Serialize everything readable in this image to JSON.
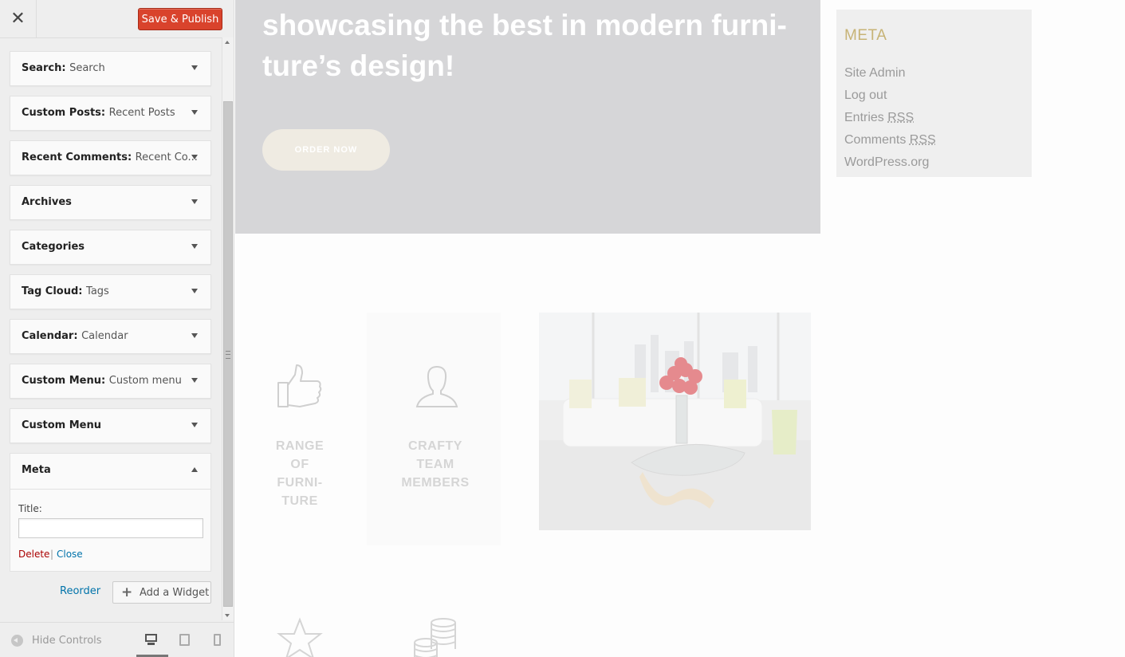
{
  "topbar": {
    "close_glyph": "✕",
    "save_label": "Save & Publish"
  },
  "widgets": [
    {
      "name": "Search",
      "sub": "Search"
    },
    {
      "name": "Custom Posts",
      "sub": "Recent Posts"
    },
    {
      "name": "Recent Comments",
      "sub": "Recent Co..."
    },
    {
      "name": "Archives",
      "sub": ""
    },
    {
      "name": "Categories",
      "sub": ""
    },
    {
      "name": "Tag Cloud",
      "sub": "Tags"
    },
    {
      "name": "Calendar",
      "sub": "Calendar"
    },
    {
      "name": "Custom Menu",
      "sub": "Custom menu"
    },
    {
      "name": "Custom Menu",
      "sub": ""
    }
  ],
  "meta_widget": {
    "name": "Meta",
    "title_label": "Title:",
    "title_value": "",
    "delete_label": "Delete",
    "separator": "|",
    "close_label": "Close"
  },
  "actions": {
    "reorder_label": "Reorder",
    "add_widget_plus": "+",
    "add_widget_label": "Add a Widget"
  },
  "footer": {
    "hide_controls_label": "Hide Controls",
    "devices": [
      "desktop-icon",
      "tablet-icon",
      "mobile-icon"
    ],
    "active_device": "desktop"
  },
  "preview": {
    "hero_heading": "showcasing the best in modern furni-ture’s design!",
    "order_button": "ORDER NOW",
    "meta": {
      "heading": "META",
      "links": [
        {
          "text": "Site Admin",
          "abbr": ""
        },
        {
          "text": "Log out",
          "abbr": ""
        },
        {
          "text": "Entries ",
          "abbr": "RSS"
        },
        {
          "text": "Comments ",
          "abbr": "RSS"
        },
        {
          "text": "WordPress.org",
          "abbr": ""
        }
      ]
    },
    "features": [
      {
        "icon": "thumbs-up-icon",
        "lines": [
          "RANGE",
          "OF",
          "FURNI-",
          "TURE"
        ]
      },
      {
        "icon": "user-icon",
        "lines": [
          "CRAFTY",
          "TEAM",
          "MEMBERS"
        ]
      },
      {
        "icon": "star-icon",
        "lines": []
      },
      {
        "icon": "coins-icon",
        "lines": []
      }
    ]
  },
  "colors": {
    "save_button": "#d9432c",
    "link_blue": "#0073aa",
    "delete_red": "#aa0000",
    "meta_heading_gold": "#c7b376",
    "hero_bg": "#d6d6d8"
  }
}
